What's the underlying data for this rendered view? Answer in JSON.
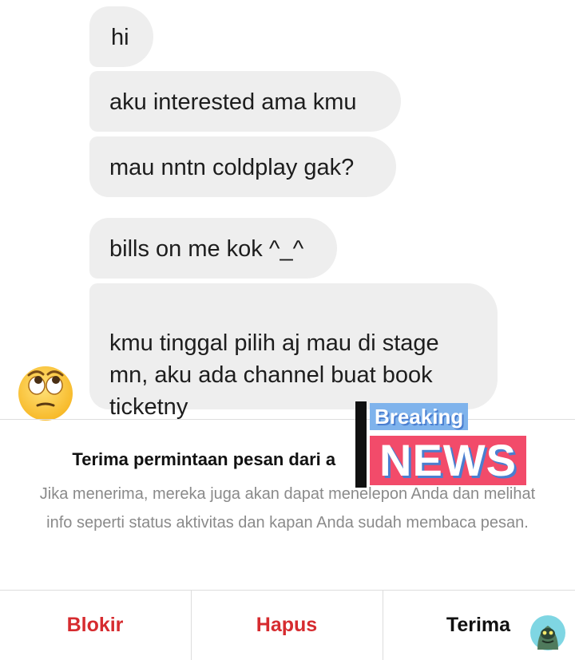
{
  "messages": [
    {
      "text": "hi"
    },
    {
      "text": "aku interested ama kmu"
    },
    {
      "text": "mau nntn coldplay gak?"
    },
    {
      "text": "bills on me kok ^_^"
    },
    {
      "text": "kmu tinggal pilih aj mau di stage\nmn, aku ada channel buat book\nticketny"
    }
  ],
  "request": {
    "title_part1": "Terima permintaan pesan dari a",
    "title_part2": "?",
    "description": "Jika menerima, mereka juga akan dapat menelepon Anda dan melihat info seperti status aktivitas dan kapan Anda sudah membaca pesan."
  },
  "actions": {
    "block": "Blokir",
    "delete": "Hapus",
    "accept": "Terima"
  },
  "overlay": {
    "line1": "Breaking",
    "line2": "NEWS"
  },
  "colors": {
    "bubble": "#eeeeee",
    "danger": "#d62b2f",
    "breaking_bg": "#7fb3ec",
    "news_bg": "#f24b6a"
  },
  "icons": {
    "sender_avatar": "eye-roll-emoji-icon",
    "account_badge": "alien-avatar-icon"
  }
}
